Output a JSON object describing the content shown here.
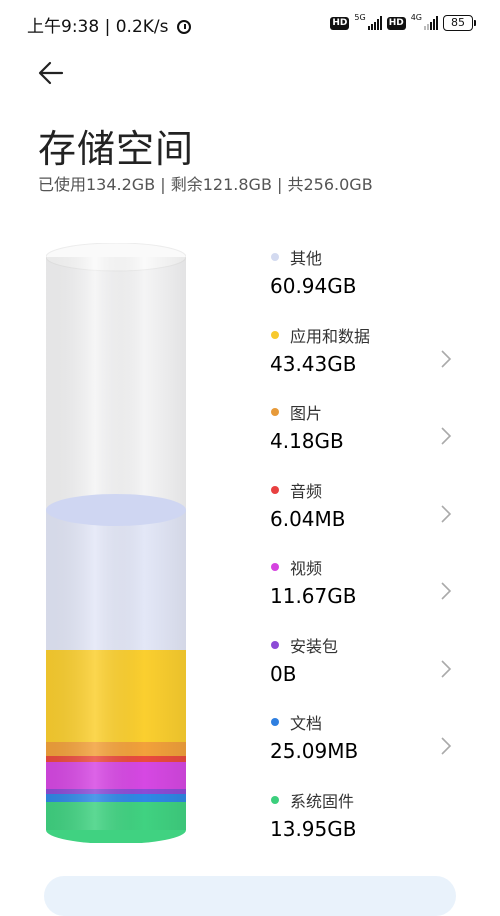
{
  "status": {
    "time": "上午9:38",
    "speed": "0.2K/s",
    "net1": "5G",
    "net2": "4G",
    "battery": "85"
  },
  "header": {
    "title": "存储空间",
    "summary": "已使用134.2GB | 剩余121.8GB | 共256.0GB"
  },
  "categories": [
    {
      "name": "其他",
      "size": "60.94GB",
      "color": "#d3daf0",
      "navigable": false
    },
    {
      "name": "应用和数据",
      "size": "43.43GB",
      "color": "#f7c92e",
      "navigable": true
    },
    {
      "name": "图片",
      "size": "4.18GB",
      "color": "#e79a3a",
      "navigable": true
    },
    {
      "name": "音频",
      "size": "6.04MB",
      "color": "#e84040",
      "navigable": true
    },
    {
      "name": "视频",
      "size": "11.67GB",
      "color": "#d543e0",
      "navigable": true
    },
    {
      "name": "安装包",
      "size": "0B",
      "color": "#8c4bd6",
      "navigable": true
    },
    {
      "name": "文档",
      "size": "25.09MB",
      "color": "#2f7fe0",
      "navigable": true
    },
    {
      "name": "系统固件",
      "size": "13.95GB",
      "color": "#3ccf7d",
      "navigable": false
    }
  ],
  "icons": {
    "back": "arrow-left-icon",
    "chevron": "chevron-right-icon",
    "alarm": "alarm-icon"
  }
}
